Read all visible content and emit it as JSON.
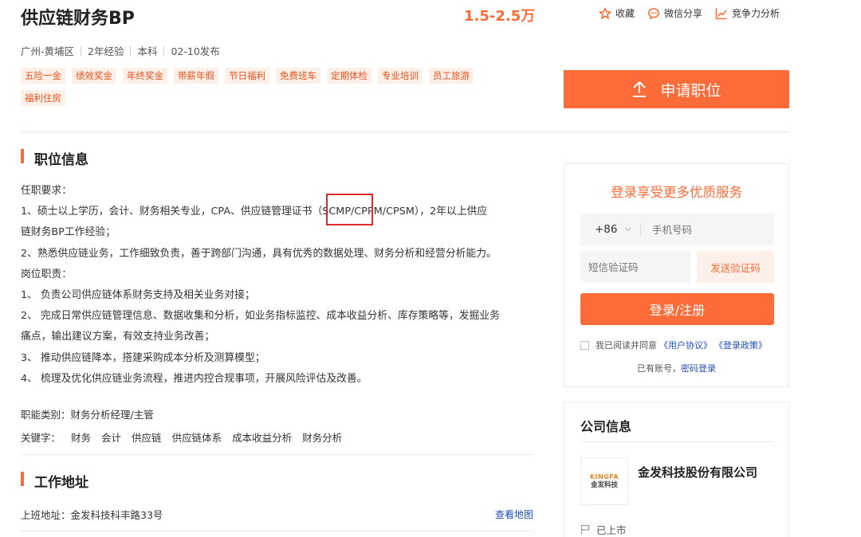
{
  "job": {
    "title": "供应链财务BP",
    "salary": "1.5-2.5万",
    "location": "广州-黄埔区",
    "experience": "2年经验",
    "education": "本科",
    "published": "02-10发布",
    "tags": [
      "五险一金",
      "绩效奖金",
      "年终奖金",
      "带薪年假",
      "节日福利",
      "免费班车",
      "定期体检",
      "专业培训",
      "员工旅游",
      "福利住房"
    ]
  },
  "actions": {
    "favorite": "收藏",
    "wechat_share": "微信分享",
    "competitiveness": "竞争力分析"
  },
  "apply": {
    "label": "申请职位"
  },
  "sections": {
    "job_info_title": "职位信息",
    "address_title": "工作地址"
  },
  "description": {
    "lines": [
      "任职要求：",
      "1、硕士以上学历，会计、财务相关专业，CPA、供应链管理证书（SCMP/CPPM/CPSM），2年以上供应",
      "链财务BP工作经验；",
      "2、熟悉供应链业务，工作细致负责，善于跨部门沟通，具有优秀的数据处理、财务分析和经营分析能力。",
      "岗位职责：",
      "1、 负责公司供应链体系财务支持及相关业务对接；",
      "2、 完成日常供应链管理信息、数据收集和分析，如业务指标监控、成本收益分析、库存策略等，发掘业务",
      "痛点，输出建议方案，有效支持业务改善；",
      "3、 推动供应链降本，搭建采购成本分析及测算模型；",
      "4、 梳理及优化供应链业务流程，推进内控合规事项，开展风险评估及改善。"
    ]
  },
  "category": {
    "label": "职能类别：",
    "value": "财务分析经理/主管"
  },
  "keywords": {
    "label": "关键字：",
    "items": [
      "财务",
      "会计",
      "供应链",
      "供应链体系",
      "成本收益分析",
      "财务分析"
    ]
  },
  "address": {
    "text": "上班地址：金发科技科丰路33号",
    "map_link": "查看地图"
  },
  "login": {
    "title": "登录享受更多优质服务",
    "country_code": "+86",
    "phone_placeholder": "手机号码",
    "code_placeholder": "短信验证码",
    "send_code": "发送验证码",
    "submit": "登录/注册",
    "agree_text": "我已阅读并同意",
    "user_agreement": "《用户协议》",
    "login_policy": "《登录政策》",
    "has_account": "已有账号，",
    "password_login": "密码登录"
  },
  "company": {
    "section_title": "公司信息",
    "logo_en": "KINGFA",
    "logo_cn": "金发科技",
    "name": "金发科技股份有限公司",
    "status": "已上市"
  },
  "colors": {
    "accent": "#fc6c38",
    "link": "#1f4fb3",
    "tag_bg": "#fdf0e8",
    "highlight": "#e0282d"
  }
}
